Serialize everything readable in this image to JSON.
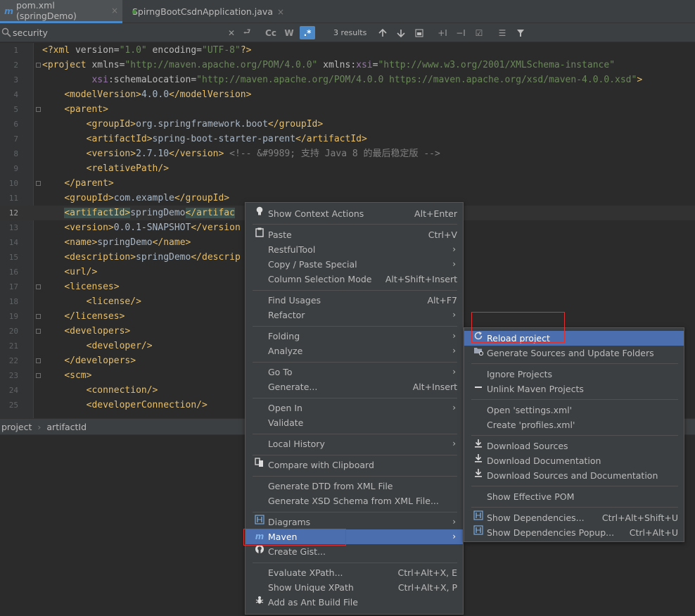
{
  "tabs": [
    {
      "icon": "m",
      "label": "pom.xml (springDemo)",
      "close": "×"
    },
    {
      "icon": "spring-boot",
      "label": "SpirngBootCsdnApplication.java",
      "close": "×"
    }
  ],
  "search": {
    "value": "security",
    "results": "3 results",
    "opt_cc": "Cc",
    "opt_w": "W",
    "opt_regex": ".*"
  },
  "editor": {
    "lines": [
      {
        "n": "1",
        "c": [
          [
            "tag",
            "<?xml "
          ],
          [
            "attr",
            "version="
          ],
          [
            "val",
            "\"1.0\""
          ],
          [
            "attr",
            " encoding="
          ],
          [
            "val",
            "\"UTF-8\""
          ],
          [
            "tag",
            "?>"
          ]
        ]
      },
      {
        "n": "2",
        "c": [
          [
            "tag",
            "<project "
          ],
          [
            "attr",
            "xmlns="
          ],
          [
            "val",
            "\"http://maven.apache.org/POM/4.0.0\""
          ],
          [
            "attr",
            " xmlns:"
          ],
          [
            "ns",
            "xsi"
          ],
          [
            "attr",
            "="
          ],
          [
            "val",
            "\"http://www.w3.org/2001/XMLSchema-instance\""
          ]
        ]
      },
      {
        "n": "3",
        "c": [
          [
            "attr",
            "         "
          ],
          [
            "ns",
            "xsi"
          ],
          [
            "attr",
            ":schemaLocation="
          ],
          [
            "val",
            "\"http://maven.apache.org/POM/4.0.0 https://maven.apache.org/xsd/maven-4.0.0.xsd\""
          ],
          [
            "tag",
            ">"
          ]
        ]
      },
      {
        "n": "4",
        "c": [
          [
            "txt",
            "    "
          ],
          [
            "tag",
            "<modelVersion>"
          ],
          [
            "txt",
            "4.0.0"
          ],
          [
            "tag",
            "</modelVersion>"
          ]
        ]
      },
      {
        "n": "5",
        "c": [
          [
            "txt",
            "    "
          ],
          [
            "tag",
            "<parent>"
          ]
        ]
      },
      {
        "n": "6",
        "c": [
          [
            "txt",
            "        "
          ],
          [
            "tag",
            "<groupId>"
          ],
          [
            "txt",
            "org.springframework.boot"
          ],
          [
            "tag",
            "</groupId>"
          ]
        ]
      },
      {
        "n": "7",
        "c": [
          [
            "txt",
            "        "
          ],
          [
            "tag",
            "<artifactId>"
          ],
          [
            "txt",
            "spring-boot-starter-parent"
          ],
          [
            "tag",
            "</artifactId>"
          ]
        ]
      },
      {
        "n": "8",
        "c": [
          [
            "txt",
            "        "
          ],
          [
            "tag",
            "<version>"
          ],
          [
            "txt",
            "2.7.10"
          ],
          [
            "tag",
            "</version>"
          ],
          [
            "cmt",
            " <!-- &#9989; 支持 Java 8 的最后稳定版 -->"
          ]
        ]
      },
      {
        "n": "9",
        "c": [
          [
            "txt",
            "        "
          ],
          [
            "tag",
            "<relativePath/>"
          ]
        ]
      },
      {
        "n": "10",
        "c": [
          [
            "txt",
            "    "
          ],
          [
            "tag",
            "</parent>"
          ]
        ]
      },
      {
        "n": "11",
        "c": [
          [
            "txt",
            "    "
          ],
          [
            "tag",
            "<groupId>"
          ],
          [
            "txt",
            "com.example"
          ],
          [
            "tag",
            "</groupId>"
          ]
        ]
      },
      {
        "n": "12",
        "c": [
          [
            "txt",
            "    "
          ],
          [
            "hltag",
            "<artifactId>"
          ],
          [
            "txt",
            "springDemo"
          ],
          [
            "hltag",
            "</artifac"
          ]
        ]
      },
      {
        "n": "13",
        "c": [
          [
            "txt",
            "    "
          ],
          [
            "tag",
            "<version>"
          ],
          [
            "txt",
            "0.0.1-SNAPSHOT"
          ],
          [
            "tag",
            "</version"
          ]
        ]
      },
      {
        "n": "14",
        "c": [
          [
            "txt",
            "    "
          ],
          [
            "tag",
            "<name>"
          ],
          [
            "txt",
            "springDemo"
          ],
          [
            "tag",
            "</name>"
          ]
        ]
      },
      {
        "n": "15",
        "c": [
          [
            "txt",
            "    "
          ],
          [
            "tag",
            "<description>"
          ],
          [
            "txt",
            "springDemo"
          ],
          [
            "tag",
            "</descrip"
          ]
        ]
      },
      {
        "n": "16",
        "c": [
          [
            "txt",
            "    "
          ],
          [
            "tag",
            "<url/>"
          ]
        ]
      },
      {
        "n": "17",
        "c": [
          [
            "txt",
            "    "
          ],
          [
            "tag",
            "<licenses>"
          ]
        ]
      },
      {
        "n": "18",
        "c": [
          [
            "txt",
            "        "
          ],
          [
            "tag",
            "<license/>"
          ]
        ]
      },
      {
        "n": "19",
        "c": [
          [
            "txt",
            "    "
          ],
          [
            "tag",
            "</licenses>"
          ]
        ]
      },
      {
        "n": "20",
        "c": [
          [
            "txt",
            "    "
          ],
          [
            "tag",
            "<developers>"
          ]
        ]
      },
      {
        "n": "21",
        "c": [
          [
            "txt",
            "        "
          ],
          [
            "tag",
            "<developer/>"
          ]
        ]
      },
      {
        "n": "22",
        "c": [
          [
            "txt",
            "    "
          ],
          [
            "tag",
            "</developers>"
          ]
        ]
      },
      {
        "n": "23",
        "c": [
          [
            "txt",
            "    "
          ],
          [
            "tag",
            "<scm>"
          ]
        ]
      },
      {
        "n": "24",
        "c": [
          [
            "txt",
            "        "
          ],
          [
            "tag",
            "<connection/>"
          ]
        ]
      },
      {
        "n": "25",
        "c": [
          [
            "txt",
            "        "
          ],
          [
            "tag",
            "<developerConnection/>"
          ]
        ]
      }
    ]
  },
  "breadcrumbs": [
    "project",
    "artifactId"
  ],
  "context_menu": [
    {
      "type": "item",
      "icon": "bulb-icon",
      "label": "Show Context Actions",
      "shortcut": "Alt+Enter"
    },
    {
      "type": "sep"
    },
    {
      "type": "item",
      "icon": "clipboard-icon",
      "label": "Paste",
      "ul": "P",
      "shortcut": "Ctrl+V"
    },
    {
      "type": "item",
      "label": "RestfulTool",
      "submenu": true
    },
    {
      "type": "item",
      "label": "Copy / Paste Special",
      "submenu": true
    },
    {
      "type": "item",
      "label": "Column Selection Mode",
      "shortcut": "Alt+Shift+Insert"
    },
    {
      "type": "sep"
    },
    {
      "type": "item",
      "label": "Find Usages",
      "shortcut": "Alt+F7"
    },
    {
      "type": "item",
      "label": "Refactor",
      "submenu": true
    },
    {
      "type": "sep"
    },
    {
      "type": "item",
      "label": "Folding",
      "submenu": true
    },
    {
      "type": "item",
      "label": "Analyze",
      "submenu": true
    },
    {
      "type": "sep"
    },
    {
      "type": "item",
      "label": "Go To",
      "submenu": true
    },
    {
      "type": "item",
      "label": "Generate...",
      "shortcut": "Alt+Insert"
    },
    {
      "type": "sep"
    },
    {
      "type": "item",
      "label": "Open In",
      "submenu": true
    },
    {
      "type": "item",
      "label": "Validate"
    },
    {
      "type": "sep"
    },
    {
      "type": "item",
      "label": "Local History",
      "submenu": true
    },
    {
      "type": "sep"
    },
    {
      "type": "item",
      "icon": "compare-icon",
      "label": "Compare with Clipboard"
    },
    {
      "type": "sep"
    },
    {
      "type": "item",
      "label": "Generate DTD from XML File"
    },
    {
      "type": "item",
      "label": "Generate XSD Schema from XML File..."
    },
    {
      "type": "sep"
    },
    {
      "type": "item",
      "icon": "diagram-icon",
      "label": "Diagrams",
      "submenu": true
    },
    {
      "type": "item",
      "icon": "maven-icon",
      "label": "Maven",
      "submenu": true,
      "selected": true
    },
    {
      "type": "item",
      "icon": "github-icon",
      "label": "Create Gist..."
    },
    {
      "type": "sep"
    },
    {
      "type": "item",
      "label": "Evaluate XPath...",
      "shortcut": "Ctrl+Alt+X, E"
    },
    {
      "type": "item",
      "label": "Show Unique XPath",
      "shortcut": "Ctrl+Alt+X, P"
    },
    {
      "type": "item",
      "icon": "ant-icon",
      "label": "Add as Ant Build File"
    }
  ],
  "maven_menu": [
    {
      "type": "item",
      "icon": "reload-icon",
      "label": "Reload project",
      "selected": true
    },
    {
      "type": "item",
      "icon": "folder-reload-icon",
      "label": "Generate Sources and Update Folders"
    },
    {
      "type": "sep"
    },
    {
      "type": "item",
      "label": "Ignore Projects"
    },
    {
      "type": "item",
      "icon": "minus-icon",
      "label": "Unlink Maven Projects"
    },
    {
      "type": "sep"
    },
    {
      "type": "item",
      "label": "Open 'settings.xml'"
    },
    {
      "type": "item",
      "label": "Create 'profiles.xml'"
    },
    {
      "type": "sep"
    },
    {
      "type": "item",
      "icon": "download-icon",
      "label": "Download Sources"
    },
    {
      "type": "item",
      "icon": "download-icon",
      "label": "Download Documentation"
    },
    {
      "type": "item",
      "icon": "download-icon",
      "label": "Download Sources and Documentation"
    },
    {
      "type": "sep"
    },
    {
      "type": "item",
      "label": "Show Effective POM"
    },
    {
      "type": "sep"
    },
    {
      "type": "item",
      "icon": "dependencies-icon",
      "label": "Show Dependencies...",
      "shortcut": "Ctrl+Alt+Shift+U"
    },
    {
      "type": "item",
      "icon": "dependencies-icon",
      "label": "Show Dependencies Popup...",
      "shortcut": "Ctrl+Alt+U"
    }
  ]
}
